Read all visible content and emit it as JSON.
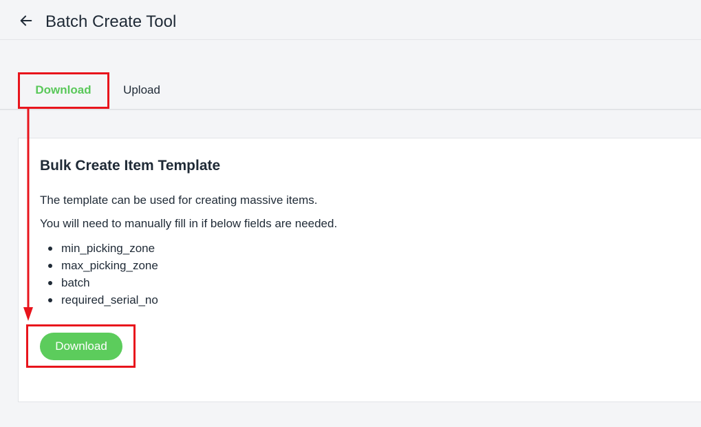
{
  "header": {
    "title": "Batch Create Tool",
    "back_icon": "arrow-left-icon"
  },
  "tabs": [
    {
      "label": "Download",
      "active": true
    },
    {
      "label": "Upload",
      "active": false
    }
  ],
  "card": {
    "title": "Bulk Create Item Template",
    "description_1": "The template can be used for creating massive items.",
    "description_2": "You will need to manually fill in if below fields are needed.",
    "fields": [
      "min_picking_zone",
      "max_picking_zone",
      "batch",
      "required_serial_no"
    ],
    "download_label": "Download"
  },
  "colors": {
    "accent": "#5ccc5c",
    "annotation": "#e8141c",
    "text": "#1f2a36",
    "background": "#f4f5f7"
  }
}
